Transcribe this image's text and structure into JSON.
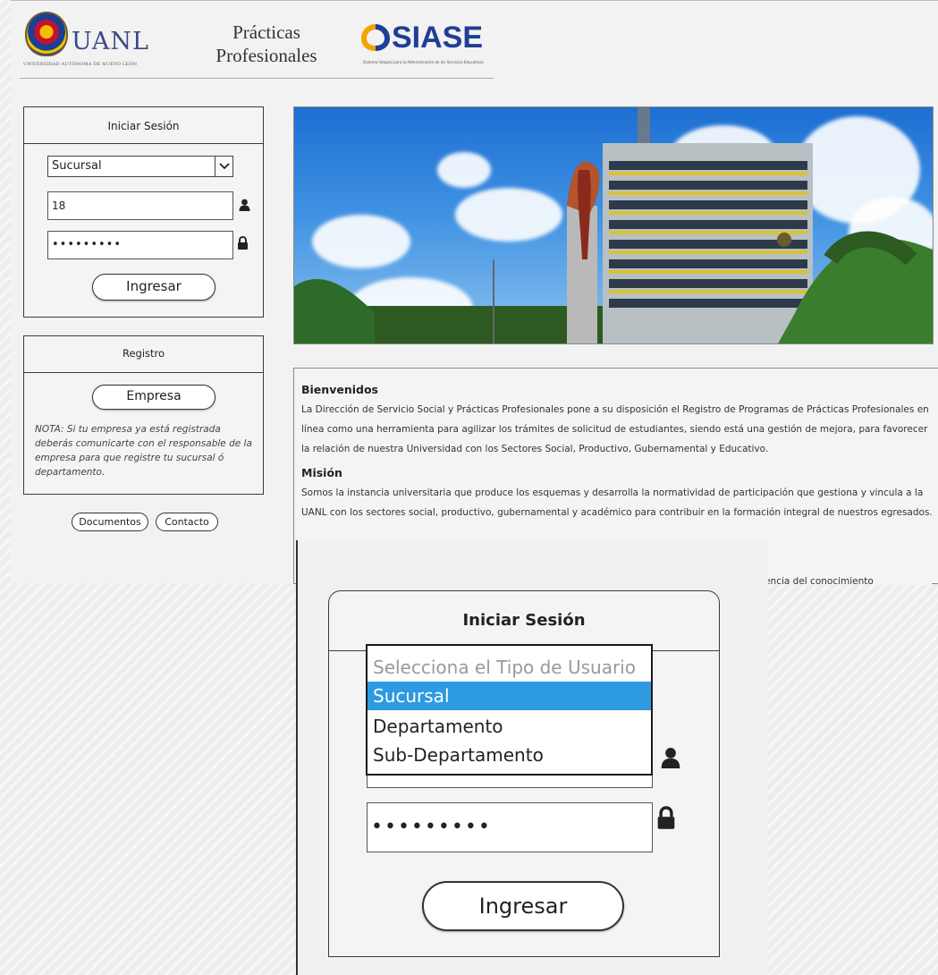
{
  "header": {
    "uanl_text": "UANL",
    "uanl_subtitle": "UNIVERSIDAD AUTÓNOMA DE NUEVO LEÓN",
    "practicas_line1": "Prácticas",
    "practicas_line2": "Profesionales",
    "siase_text": "SIASE",
    "siase_subtitle": "Sistema Integral para la Administración de los Servicios Educativos"
  },
  "login": {
    "title": "Iniciar Sesión",
    "user_type_value": "Sucursal",
    "user_value": "18",
    "password_value": "•••••••••",
    "submit_label": "Ingresar"
  },
  "registro": {
    "title": "Registro",
    "empresa_label": "Empresa",
    "note": "NOTA: Si tu empresa ya está registrada deberás comunicarte con el responsable de la empresa para que registre tu sucursal ó departamento."
  },
  "footer_links": {
    "documentos": "Documentos",
    "contacto": "Contacto"
  },
  "content": {
    "bienvenidos_title": "Bienvenidos",
    "bienvenidos_text": "La Dirección de Servicio Social y Prácticas Profesionales pone a su disposición el Registro de Programas de Prácticas Profesionales en línea como una herramienta para agilizar los trámites de solicitud de estudiantes, siendo está una gestión de mejora, para favorecer la relación de nuestra Universidad con los Sectores Social, Productivo, Gubernamental y Educativo.",
    "mision_title": "Misión",
    "mision_text": "Somos la instancia universitaria que produce los esquemas y desarrolla la normatividad de participación que gestiona y vincula a la UANL con los sectores social, productivo, gubernamental y académico para contribuir en la formación integral de nuestros egresados.",
    "truncated_text": "rencia del conocimiento"
  },
  "zoom": {
    "title": "Iniciar Sesión",
    "dropdown_options": [
      "Selecciona el Tipo de Usuario",
      "Sucursal",
      "Departamento",
      "Sub-Departamento"
    ],
    "selected_index": 1,
    "password_value": "•••••••••",
    "submit_label": "Ingresar"
  },
  "colors": {
    "selected_option": "#2d9ae2",
    "uanl_blue": "#3b4a86",
    "siase_blue": "#1f3e94"
  },
  "icons": [
    "user-icon",
    "lock-icon",
    "chevron-down-icon"
  ]
}
